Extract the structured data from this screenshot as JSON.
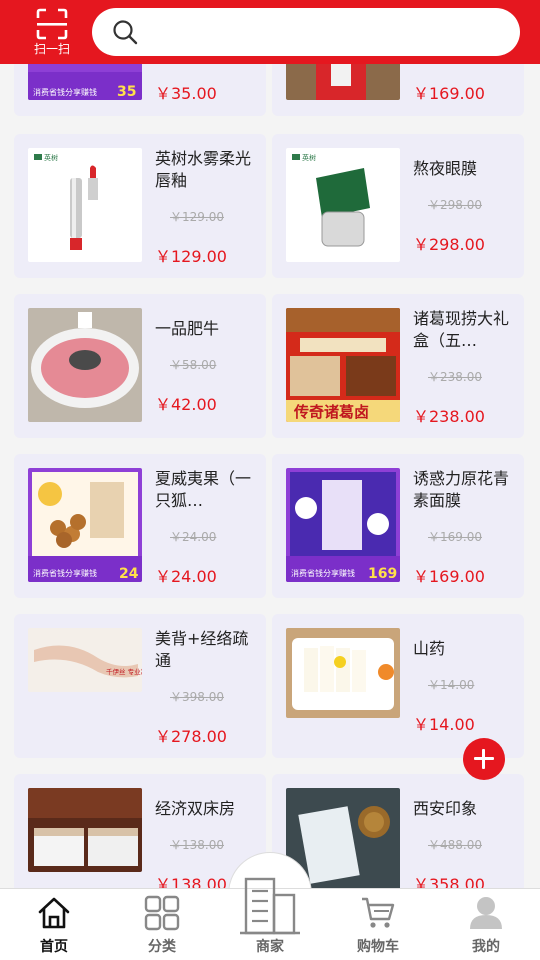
{
  "header": {
    "scan_label": "扫一扫",
    "search_placeholder": ""
  },
  "products": [
    {
      "name": "",
      "old_price": "",
      "price": "￥35.00",
      "badge_price": "35",
      "badge_text": "消费省钱分享赚钱"
    },
    {
      "name": "",
      "old_price": "",
      "price": "￥169.00"
    },
    {
      "name": "英树水雾柔光唇釉",
      "old_price": "￥129.00",
      "price": "￥129.00",
      "brand": "英树"
    },
    {
      "name": "熬夜眼膜",
      "old_price": "￥298.00",
      "price": "￥298.00",
      "brand": "英树"
    },
    {
      "name": "一品肥牛",
      "old_price": "￥58.00",
      "price": "￥42.00"
    },
    {
      "name": "诸葛现捞大礼盒（五…",
      "old_price": "￥238.00",
      "price": "￥238.00",
      "banner": "传奇诸葛卤"
    },
    {
      "name": "夏威夷果（一只狐…",
      "old_price": "￥24.00",
      "price": "￥24.00",
      "badge_price": "24",
      "badge_text": "消费省钱分享赚钱"
    },
    {
      "name": "诱惑力原花青素面膜",
      "old_price": "￥169.00",
      "price": "￥169.00",
      "badge_price": "169",
      "badge_text": "消费省钱分享赚钱"
    },
    {
      "name": "美背+经络疏通",
      "old_price": "￥398.00",
      "price": "￥278.00",
      "image_text": "千伊丝 专业减肥 塑形 瘦身"
    },
    {
      "name": "山药",
      "old_price": "￥14.00",
      "price": "￥14.00"
    },
    {
      "name": "经济双床房",
      "old_price": "￥138.00",
      "price": "￥138.00"
    },
    {
      "name": "西安印象",
      "old_price": "￥488.00",
      "price": "￥358.00"
    }
  ],
  "nav": {
    "items": [
      {
        "label": "首页",
        "icon": "home-icon",
        "active": true
      },
      {
        "label": "分类",
        "icon": "grid-icon",
        "active": false
      },
      {
        "label": "商家",
        "icon": "building-icon",
        "active": false
      },
      {
        "label": "购物车",
        "icon": "cart-icon",
        "active": false
      },
      {
        "label": "我的",
        "icon": "user-icon",
        "active": false
      }
    ]
  },
  "colors": {
    "brand_red": "#e5171f",
    "card_bg": "#eeedf8",
    "page_bg": "#f4f4f4"
  }
}
